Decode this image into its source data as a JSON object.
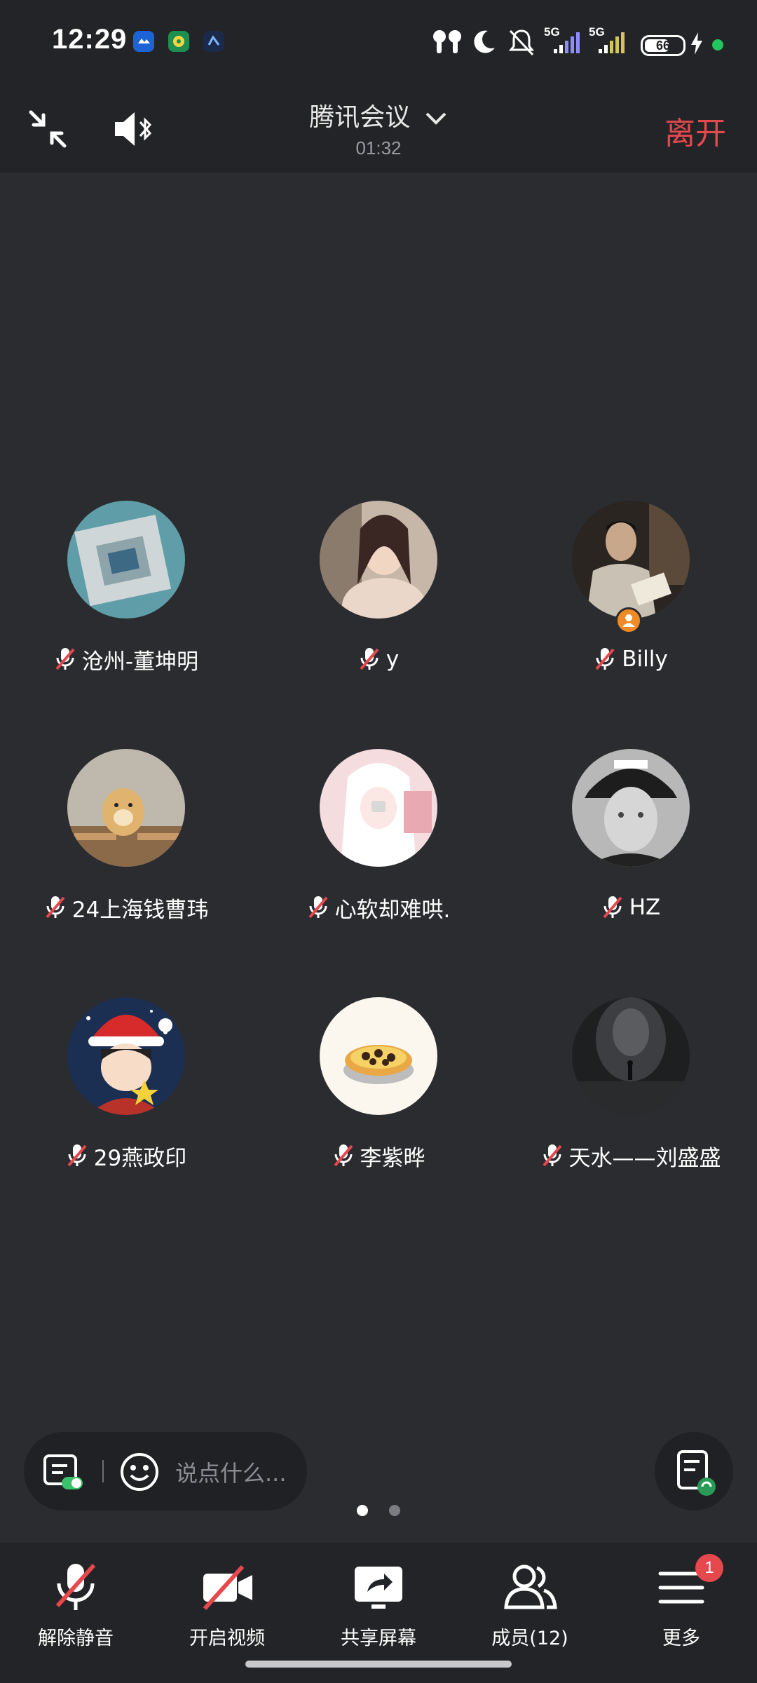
{
  "status_bar": {
    "time": "12:29",
    "app_icons": [
      "mail-app-icon",
      "music-app-icon",
      "game-app-icon"
    ],
    "network_1": "5G",
    "network_2": "5G",
    "battery_percent": "66",
    "battery_level": 0.66,
    "icons": [
      "earbuds-icon",
      "moon-icon",
      "mute-bell-icon",
      "signal-icon",
      "signal-icon",
      "battery-icon",
      "charging-icon",
      "privacy-dot-icon"
    ]
  },
  "header": {
    "title": "腾讯会议",
    "timer": "01:32",
    "leave_label": "离开",
    "icons": [
      "minimize-icon",
      "bluetooth-speaker-icon",
      "chevron-down-icon"
    ]
  },
  "participants": [
    {
      "name": "沧州-董坤明",
      "muted": true,
      "avatar": "cpu-chip-photo"
    },
    {
      "name": "y",
      "muted": true,
      "avatar": "girl-photo"
    },
    {
      "name": "Billy",
      "muted": true,
      "avatar": "man-reading-photo",
      "host": true
    },
    {
      "name": "24上海钱曹玮",
      "muted": true,
      "avatar": "doge-photo"
    },
    {
      "name": "心软却难哄.",
      "muted": true,
      "avatar": "pink-anime-photo"
    },
    {
      "name": "HZ",
      "muted": true,
      "avatar": "man-cap-photo"
    },
    {
      "name": "29燕政印",
      "muted": true,
      "avatar": "christmas-boy-photo"
    },
    {
      "name": "李紫晔",
      "muted": true,
      "avatar": "egg-tart-photo"
    },
    {
      "name": "天水——刘盛盛",
      "muted": true,
      "avatar": "dark-corridor-photo"
    }
  ],
  "chat": {
    "placeholder": "说点什么..."
  },
  "pagination": {
    "pages": 2,
    "current": 1
  },
  "toolbar": {
    "unmute_label": "解除静音",
    "video_label": "开启视频",
    "share_label": "共享屏幕",
    "members_label": "成员(12)",
    "more_label": "更多",
    "more_badge": "1"
  },
  "colors": {
    "background": "#2b2c30",
    "bar": "#232427",
    "leave": "#e5484d",
    "host_badge": "#f08a24",
    "muted_slash": "#e5484d"
  }
}
